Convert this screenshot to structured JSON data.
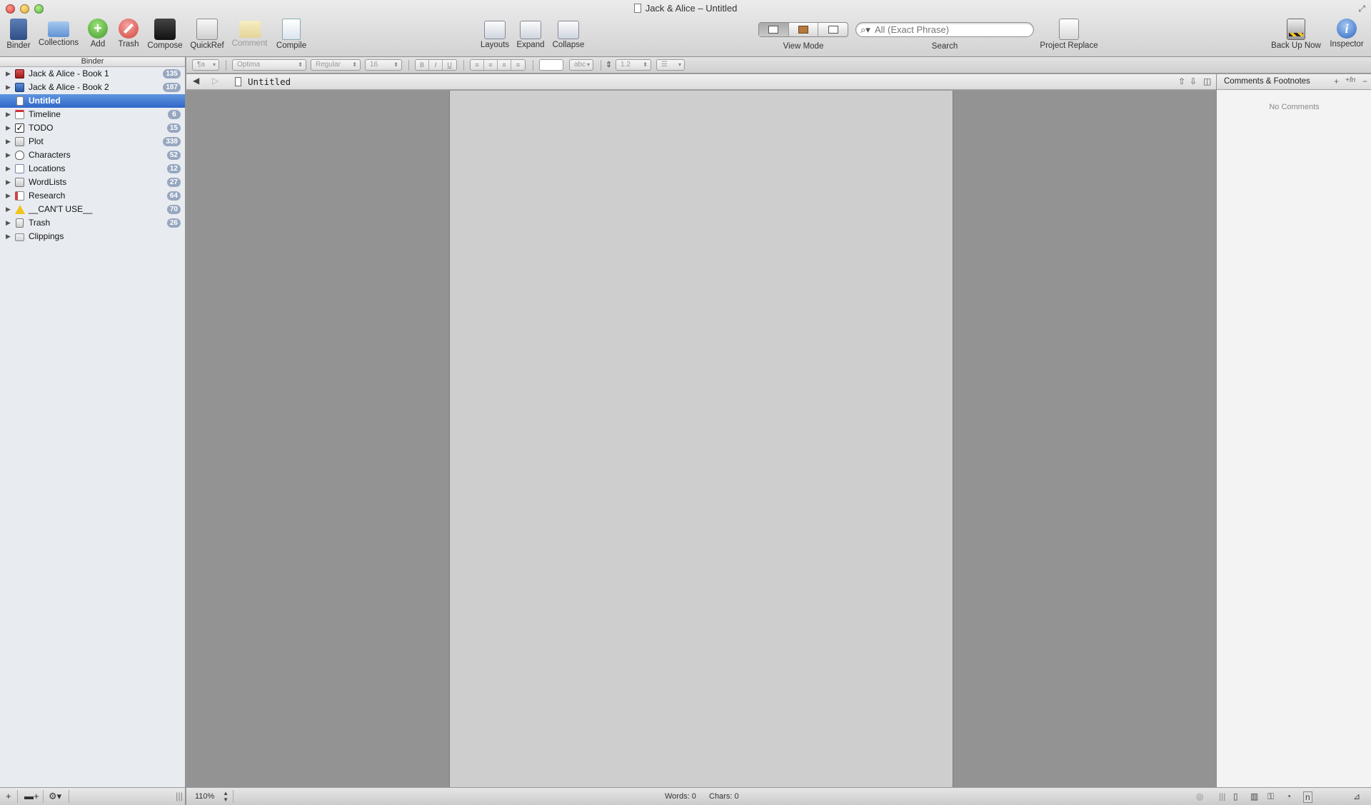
{
  "window": {
    "title": "Jack & Alice – Untitled"
  },
  "toolbar": {
    "binder": "Binder",
    "collections": "Collections",
    "add": "Add",
    "trash": "Trash",
    "compose": "Compose",
    "quickref": "QuickRef",
    "comment": "Comment",
    "compile": "Compile",
    "layouts": "Layouts",
    "expand": "Expand",
    "collapse": "Collapse",
    "view_mode": "View Mode",
    "search_label": "Search",
    "search_placeholder": "All (Exact Phrase)",
    "project_replace": "Project Replace",
    "back_up_now": "Back Up Now",
    "inspector": "Inspector"
  },
  "binder": {
    "header": "Binder",
    "items": [
      {
        "label": "Jack & Alice - Book 1",
        "count": "135",
        "icon": "red-book-icon"
      },
      {
        "label": "Jack & Alice - Book 2",
        "count": "187",
        "icon": "blue-book-icon"
      },
      {
        "label": "Untitled",
        "count": "",
        "icon": "document-icon",
        "selected": true
      },
      {
        "label": "Timeline",
        "count": "6",
        "icon": "calendar-icon"
      },
      {
        "label": "TODO",
        "count": "15",
        "icon": "checkbox-icon"
      },
      {
        "label": "Plot",
        "count": "338",
        "icon": "stack-icon"
      },
      {
        "label": "Characters",
        "count": "52",
        "icon": "mask-icon"
      },
      {
        "label": "Locations",
        "count": "12",
        "icon": "chart-icon"
      },
      {
        "label": "WordLists",
        "count": "27",
        "icon": "stack-icon"
      },
      {
        "label": "Research",
        "count": "64",
        "icon": "research-icon"
      },
      {
        "label": "__CAN'T USE__",
        "count": "70",
        "icon": "warning-icon"
      },
      {
        "label": "Trash",
        "count": "26",
        "icon": "trash-can-icon"
      },
      {
        "label": "Clippings",
        "count": "",
        "icon": "folder-icon"
      }
    ]
  },
  "formatbar": {
    "style": "¶a",
    "font": "Optima",
    "weight": "Regular",
    "size": "16",
    "bold": "B",
    "italic": "I",
    "underline": "U",
    "highlight": "abc",
    "line_spacing": "1.2"
  },
  "editor": {
    "doc_title": "Untitled"
  },
  "comments": {
    "title": "Comments & Footnotes",
    "empty": "No Comments"
  },
  "statusbar": {
    "zoom": "110%",
    "words": "Words: 0",
    "chars": "Chars: 0"
  }
}
